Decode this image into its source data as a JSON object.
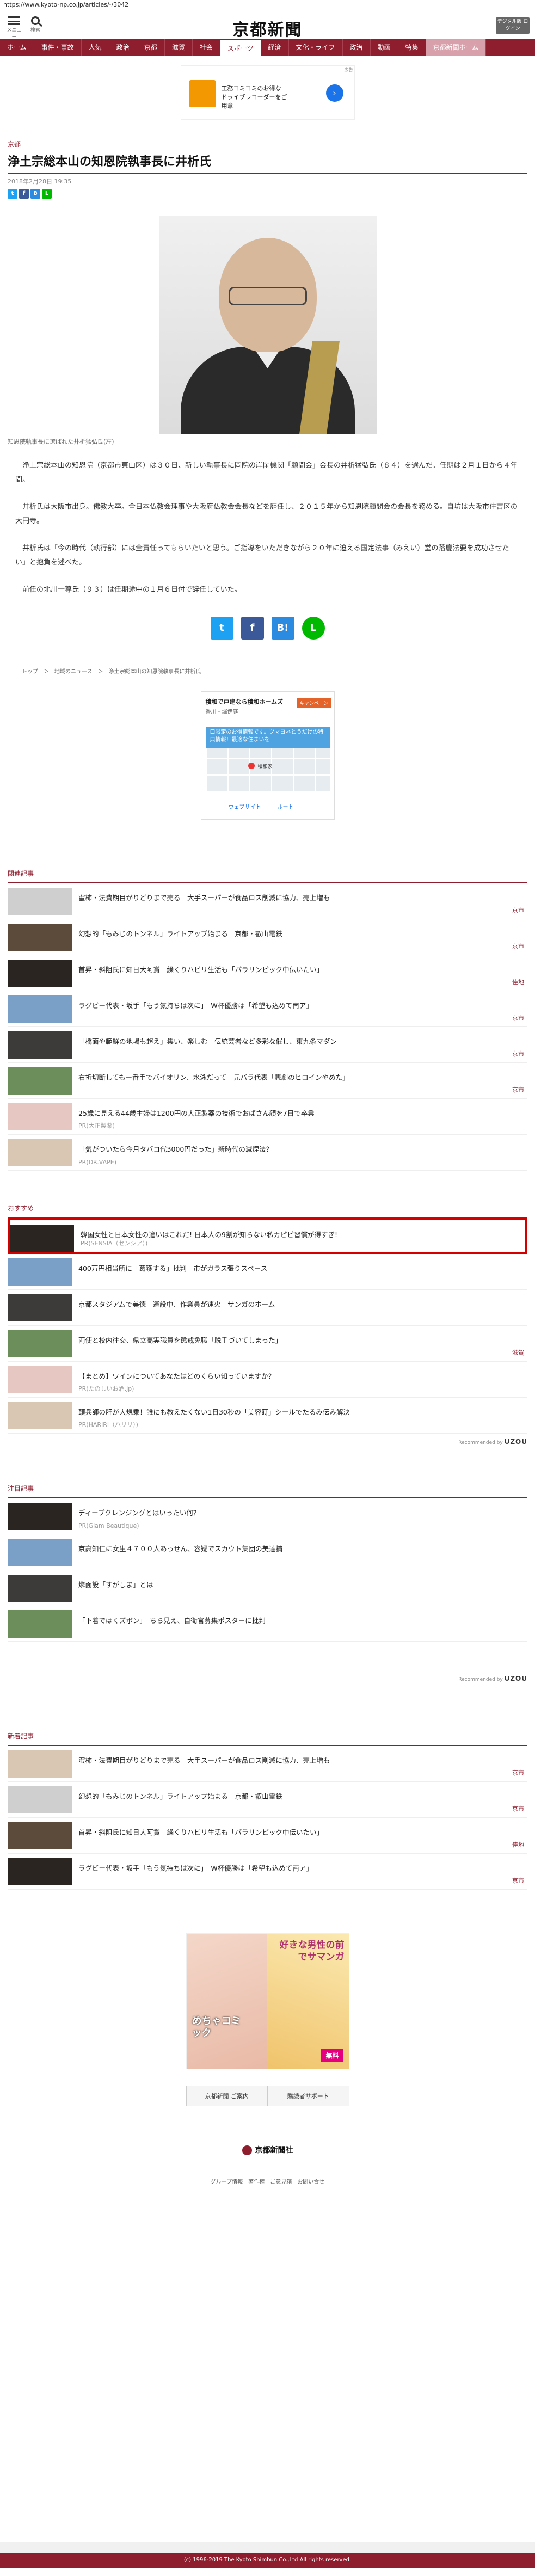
{
  "url": "https://www.kyoto-np.co.jp/articles/-/3042",
  "header": {
    "menu_label": "メニュー",
    "search_label": "検索",
    "logo": "京都新聞",
    "dsub": "デジタル版\nログイン"
  },
  "nav": [
    "ホーム",
    "事件・事故",
    "人気",
    "政治",
    "京都",
    "滋賀",
    "社会",
    "スポーツ",
    "経済",
    "文化・ライフ",
    "政治",
    "動画",
    "特集",
    "京都新聞ホーム"
  ],
  "ad_top": {
    "text": "工務コミコミのお得な\nドライブレコーダーをご\n用意",
    "tag": "広告"
  },
  "article": {
    "section": "京都",
    "title": "浄土宗総本山の知恩院執事長に井析氏",
    "date": "2018年2月28日 19:35",
    "caption": "知恩院執事長に選ばれた井析猛弘氏(左)",
    "paragraphs": [
      "浄土宗総本山の知恩院（京都市東山区）は３０日、新しい執事長に岡院の岸閑機関「顧問会」会長の井析猛弘氏（８４）を選んだ。任期は２月１日から４年間。",
      "井析氏は大阪市出身。佛教大卒。全日本仏教会理事や大阪府仏教会会長などを歴任し、２０１５年から知恩院顧問会の会長を務める。自坊は大阪市住吉区の大円寺。",
      "井析氏は「今の時代（執行部）には全責任ってもらいたいと思う。ご指導をいただきながら２０年に迫える国定法事（みえい）堂の落慶法要を成功させたい」と抱負を述べた。",
      "前任の北川一尊氏（９３）は任期途中の１月６日付で辞任していた。"
    ],
    "breadcrumb": "トップ　＞　地域のニュース　＞　浄土宗総本山の知恩院執事長に井析氏"
  },
  "map_ad": {
    "title": "積和で戸建なら積和ホームズ",
    "subtitle": "香川・堀伊庭",
    "tag": "キャンペーン",
    "dir": "ルート",
    "bubble": "口限定のお得情報です。ツマヨネとうだけの特典情報！最適な住まいを",
    "pin": "積和家",
    "btn1": "ウェブサイト",
    "btn2": "ルート"
  },
  "related": {
    "heading": "関連記事",
    "items": [
      {
        "title": "蜜柿・法費期目がりどりまで売る　大手スーパーが食品ロス削減に協力、売上増も",
        "section": "京市"
      },
      {
        "title": "幻想的「もみじのトンネル」ライトアップ始まる　京都・叡山電鉄",
        "section": "京市"
      },
      {
        "title": "首昇・斜阻氏に知日大阿賞　繰くりハビリ生活も「パラリンピック中伝いたい」",
        "section": "佳地"
      },
      {
        "title": "ラグビー代表・坂手「もう気持ちは次に」　W杯優勝は「希望も込めて南ア」",
        "section": "京市"
      },
      {
        "title": "「橋面や範鮮の地場も超え」集い、楽しむ　伝統芸者など多彩な催し、東九条マダン",
        "section": "京市"
      },
      {
        "title": "右折切断してもー番手でバイオリン、水泳だって　元バラ代表「悲劇のヒロインやめた」",
        "section": "京市"
      },
      {
        "title": "25歳に見える44歳主婦は1200円の大正製薬の技術でおばさん顔を7日で卒業",
        "sub": "PR(大正製薬)"
      },
      {
        "title": "「気がついたら今月タバコ代3000円だった」新時代の減煙法？",
        "sub": "PR(DR.VAPE)"
      }
    ]
  },
  "recommend": {
    "heading": "おすすめ",
    "items": [
      {
        "title": "韓国女性と日本女性の違いはこれだ! 日本人の9割が知らない私カピピ習慣が得すぎ!",
        "sub": "PR(SENSIA（センシア）)"
      },
      {
        "title": "400万円相当所に「葛獲する」批判　市がガラス張りスペース",
        "section": ""
      },
      {
        "title": "京都スタジアムで美徳　運設中、作業員が速火　サンガのホーム",
        "section": ""
      },
      {
        "title": "両使と校内往交、県立高実職員を懲戒免職「脱手づいてしまった」",
        "section": "滋賀"
      },
      {
        "title": "【まとめ】ワインについてあなたはどのくらい知っていますか？",
        "sub": "PR(たのしいお酒.jp)"
      },
      {
        "title": "頭兵師の肝が大規乗！誰にも教えたくない1日30秒の「美容蒔」シールでたるみ伝み解決",
        "sub": "PR(HARIRI（ハリリ）)"
      }
    ],
    "powered": "Recommended by",
    "brand": "UZOU"
  },
  "attention": {
    "heading": "注目記事",
    "items": [
      {
        "title": "ディープクレンジングとはいったい何？",
        "sub": "PR(Glam Beautique)"
      },
      {
        "title": "京高知仁に女生４７００人あっせん、容疑でスカウト集団の美達捕",
        "section": ""
      },
      {
        "title": "燐面設「すがしま」とは",
        "section": ""
      },
      {
        "title": "「下着ではくズボン」　ちら見え、自衛官募集ポスターに批判",
        "section": ""
      }
    ],
    "powered": "Recommended by",
    "brand": "UZOU"
  },
  "latest": {
    "heading": "新着記事",
    "items": [
      {
        "title": "蜜柿・法費期目がりどりまで売る　大手スーパーが食品ロス削減に協力、売上増も",
        "section": "京市"
      },
      {
        "title": "幻想的「もみじのトンネル」ライトアップ始まる　京都・叡山電鉄",
        "section": "京市"
      },
      {
        "title": "首昇・斜阻氏に知日大阿賞　繰くりハビリ生活も「パラリンピック中伝いたい」",
        "section": "佳地"
      },
      {
        "title": "ラグビー代表・坂手「もう気持ちは次に」　W杯優勝は「希望も込めて南ア」",
        "section": "京市"
      }
    ]
  },
  "big_ad": {
    "title": "好きな男性の前でサマンガ",
    "left": "めちゃコミック",
    "badge": "無料"
  },
  "footer_buttons": [
    "京都新聞 ご案内",
    "購読者サポート"
  ],
  "footer_logo": "京都新聞社",
  "footer_links": "グループ情報　著作権　ご意見箱　お問い合せ",
  "copyright": "(c) 1996-2019 The Kyoto Shimbun Co.,Ltd All rights reserved."
}
